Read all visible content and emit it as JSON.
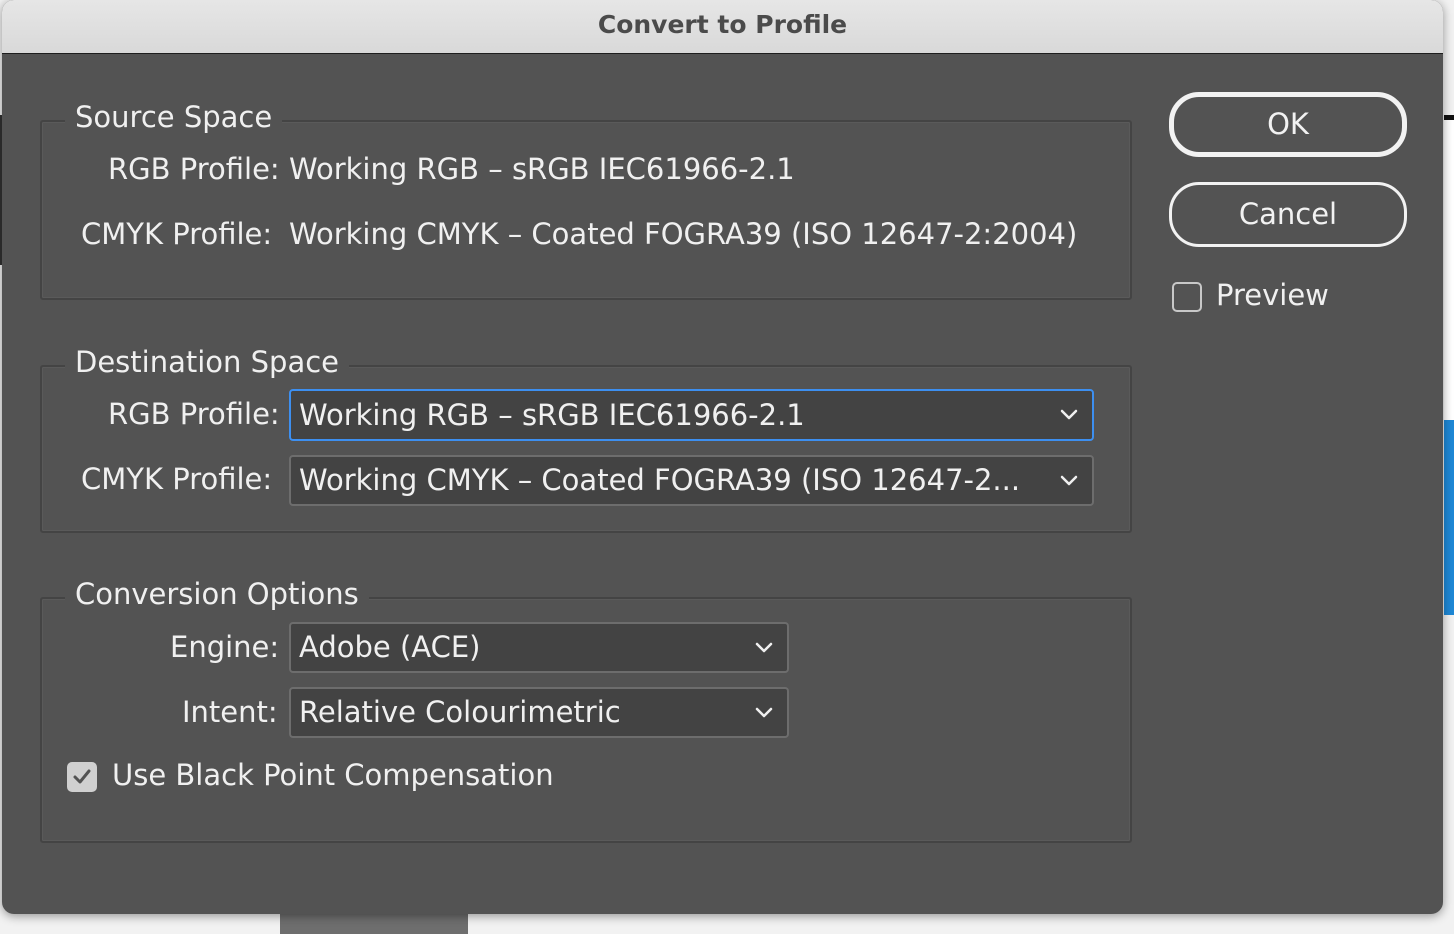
{
  "dialog": {
    "title": "Convert to Profile"
  },
  "source_space": {
    "legend": "Source Space",
    "rgb_label": "RGB Profile:",
    "rgb_value": "Working RGB – sRGB IEC61966-2.1",
    "cmyk_label": "CMYK Profile:",
    "cmyk_value": "Working CMYK – Coated FOGRA39 (ISO 12647-2:2004)"
  },
  "destination_space": {
    "legend": "Destination Space",
    "rgb_label": "RGB Profile:",
    "rgb_selected": "Working RGB – sRGB IEC61966-2.1",
    "cmyk_label": "CMYK Profile:",
    "cmyk_selected": "Working CMYK – Coated FOGRA39 (ISO 12647-2..."
  },
  "conversion_options": {
    "legend": "Conversion Options",
    "engine_label": "Engine:",
    "engine_selected": "Adobe (ACE)",
    "intent_label": "Intent:",
    "intent_selected": "Relative Colourimetric",
    "black_point_label": "Use Black Point Compensation",
    "black_point_checked": true
  },
  "buttons": {
    "ok_label": "OK",
    "cancel_label": "Cancel"
  },
  "preview": {
    "label": "Preview",
    "checked": false
  },
  "colors": {
    "dialog_bg": "#535353",
    "focus_ring": "#3d8ff0",
    "text": "#f0f0f0"
  }
}
